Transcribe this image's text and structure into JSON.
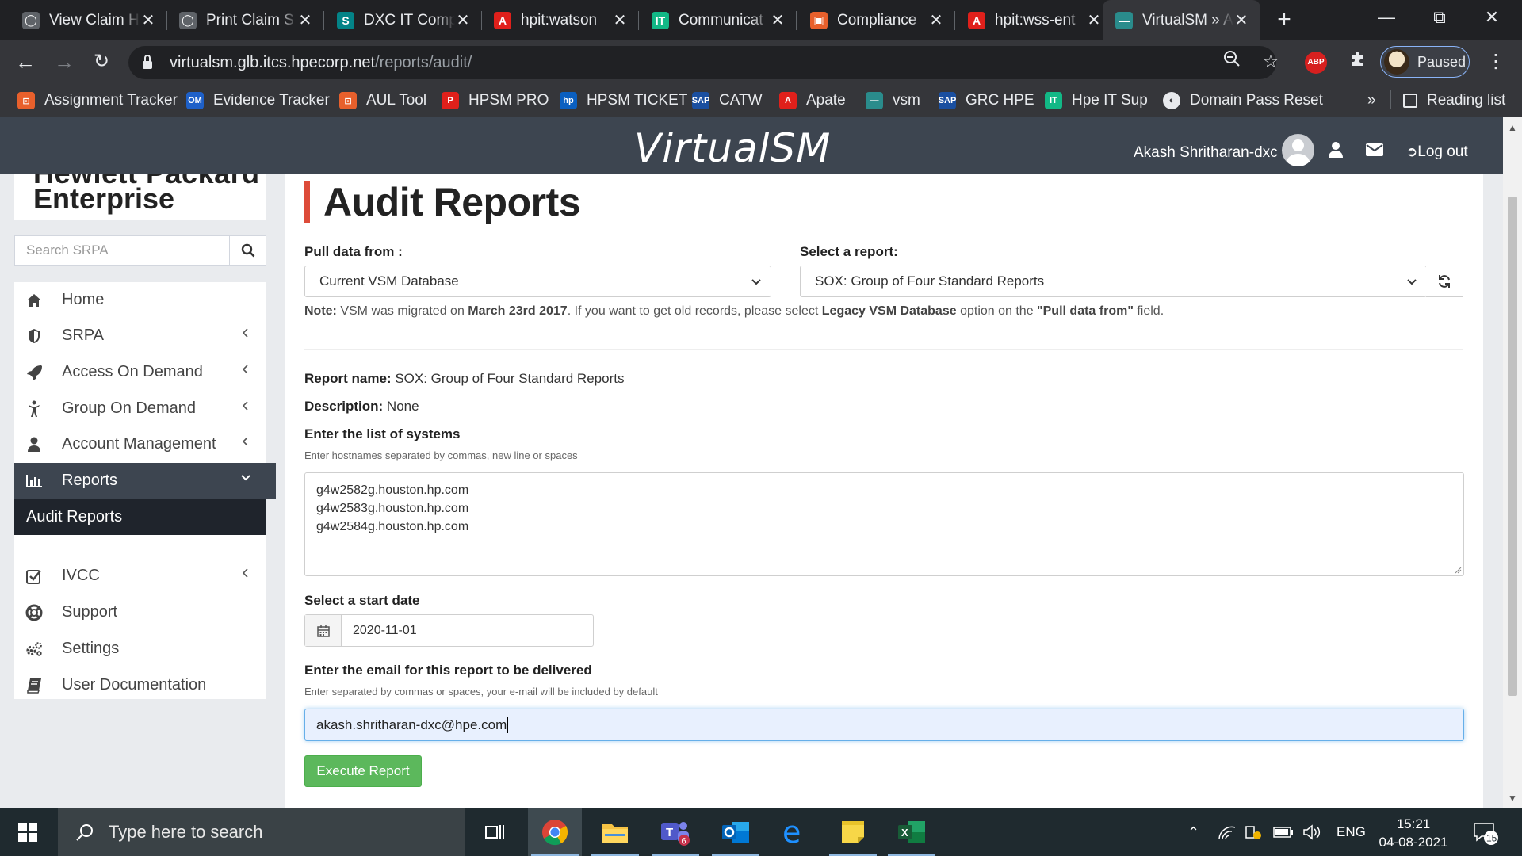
{
  "browser": {
    "tabs": [
      {
        "title": "View Claim H",
        "icon": "globe-icon",
        "color": "#5f6368"
      },
      {
        "title": "Print Claim S",
        "icon": "globe-icon",
        "color": "#5f6368"
      },
      {
        "title": "DXC IT Comp",
        "icon": "sharepoint-icon",
        "color": "#038387"
      },
      {
        "title": "hpit:watson",
        "icon": "acrobat-icon",
        "color": "#e0201b"
      },
      {
        "title": "Communicat",
        "icon": "it-icon",
        "color": "#12b886"
      },
      {
        "title": "Compliance",
        "icon": "office-icon",
        "color": "#e8602c"
      },
      {
        "title": "hpit:wss-ent",
        "icon": "acrobat-icon",
        "color": "#e0201b"
      },
      {
        "title": "VirtualSM » A",
        "icon": "vsm-icon",
        "color": "#2a8c8c"
      }
    ],
    "url_host": "virtualsm.glb.itcs.hpecorp.net",
    "url_path": "/reports/audit/",
    "profile_label": "Paused",
    "bookmarks": [
      {
        "label": "Assignment Tracker",
        "color": "#e8602c",
        "glyph": "⊡"
      },
      {
        "label": "Evidence Tracker",
        "color": "#1e60c8",
        "glyph": "OM"
      },
      {
        "label": "AUL Tool",
        "color": "#e8602c",
        "glyph": "⊡"
      },
      {
        "label": "HPSM PRO",
        "color": "#e0201b",
        "glyph": "P"
      },
      {
        "label": "HPSM TICKET",
        "color": "#0a5fc0",
        "glyph": "hp"
      },
      {
        "label": "CATW",
        "color": "#1a4fa0",
        "glyph": "SAP"
      },
      {
        "label": "Apate",
        "color": "#e0201b",
        "glyph": "A"
      },
      {
        "label": "vsm",
        "color": "#2a8c8c",
        "glyph": "—"
      },
      {
        "label": "GRC HPE",
        "color": "#1a4fa0",
        "glyph": "SAP"
      },
      {
        "label": "Hpe IT Sup",
        "color": "#12b886",
        "glyph": "IT"
      },
      {
        "label": "Domain Pass Reset",
        "color": "#e8eaed",
        "glyph": "◐"
      }
    ],
    "overflow_label": "»",
    "reading_list_label": "Reading list"
  },
  "header": {
    "brand": "VirtualSM",
    "user_name": "Akash Shritharan-dxc",
    "logout_label": "Log out"
  },
  "sidebar": {
    "logo_line1": "Hewlett Packard",
    "logo_line2": "Enterprise",
    "search_placeholder": "Search SRPA",
    "items": [
      {
        "label": "Home",
        "icon": "home-icon",
        "has_submenu": false
      },
      {
        "label": "SRPA",
        "icon": "shield-icon",
        "has_submenu": true
      },
      {
        "label": "Access On Demand",
        "icon": "rocket-icon",
        "has_submenu": true
      },
      {
        "label": "Group On Demand",
        "icon": "group-icon",
        "has_submenu": true
      },
      {
        "label": "Account Management",
        "icon": "user-icon",
        "has_submenu": true
      },
      {
        "label": "Reports",
        "icon": "bar-chart-icon",
        "has_submenu": true,
        "active": true
      },
      {
        "label": "Audit Reports",
        "icon": "",
        "sub": true
      },
      {
        "label": "IVCC",
        "icon": "checkbox-icon",
        "has_submenu": true
      },
      {
        "label": "Support",
        "icon": "lifebuoy-icon",
        "has_submenu": false
      },
      {
        "label": "Settings",
        "icon": "gears-icon",
        "has_submenu": false
      },
      {
        "label": "User Documentation",
        "icon": "book-icon",
        "has_submenu": false
      }
    ]
  },
  "main": {
    "title": "Audit Reports",
    "pull_label": "Pull data from :",
    "pull_value": "Current VSM Database",
    "report_label": "Select a report:",
    "report_value": "SOX: Group of Four Standard Reports",
    "note": {
      "prefix": "Note:",
      "t1": " VSM was migrated on ",
      "date": "March 23rd 2017",
      "t2": ". If you want to get old records, please select ",
      "option": "Legacy VSM Database",
      "t3": " option on the ",
      "field": "\"Pull data from\"",
      "t4": " field."
    },
    "report_name_label": "Report name:",
    "report_name_value": "SOX: Group of Four Standard Reports",
    "description_label": "Description:",
    "description_value": "None",
    "systems_label": "Enter the list of systems",
    "systems_hint": "Enter hostnames separated by commas, new line or spaces",
    "systems": [
      "g4w2582g.houston.hp.com",
      "g4w2583g.houston.hp.com",
      "g4w2584g.houston.hp.com"
    ],
    "start_date_label": "Select a start date",
    "start_date_value": "2020-11-01",
    "email_label": "Enter the email for this report to be delivered",
    "email_hint": "Enter separated by commas or spaces, your e-mail will be included by default",
    "email_value": "akash.shritharan-dxc@hpe.com",
    "execute_label": "Execute Report"
  },
  "taskbar": {
    "search_placeholder": "Type here to search",
    "language": "ENG",
    "time": "15:21",
    "date": "04-08-2021",
    "notification_count": "15",
    "teams_badge": "6"
  }
}
